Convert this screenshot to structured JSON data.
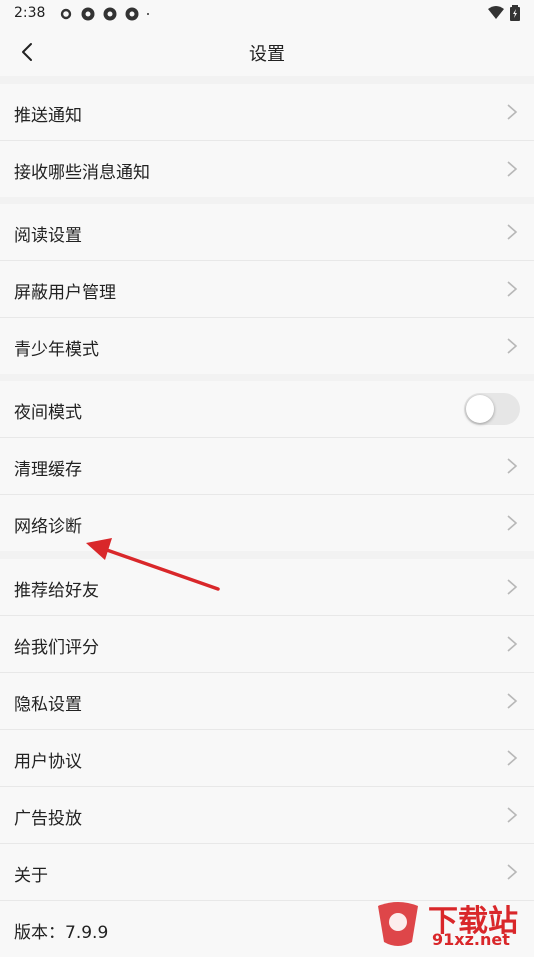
{
  "status": {
    "time": "2:38"
  },
  "header": {
    "title": "设置"
  },
  "sections": [
    {
      "items": [
        {
          "label": "推送通知"
        },
        {
          "label": "接收哪些消息通知"
        }
      ]
    },
    {
      "items": [
        {
          "label": "阅读设置"
        },
        {
          "label": "屏蔽用户管理"
        },
        {
          "label": "青少年模式"
        }
      ]
    },
    {
      "items": [
        {
          "label": "夜间模式",
          "toggle": false
        },
        {
          "label": "清理缓存"
        },
        {
          "label": "网络诊断"
        }
      ]
    },
    {
      "items": [
        {
          "label": "推荐给好友"
        },
        {
          "label": "给我们评分"
        },
        {
          "label": "隐私设置"
        },
        {
          "label": "用户协议"
        },
        {
          "label": "广告投放"
        },
        {
          "label": "关于"
        },
        {
          "label": "版本：7.9.9"
        }
      ]
    }
  ],
  "watermark": {
    "text": "下载站",
    "url": "91xz.net"
  },
  "colors": {
    "accent": "#d9272a",
    "background": "#f2f2f2",
    "row_bg": "#f8f8f8"
  }
}
